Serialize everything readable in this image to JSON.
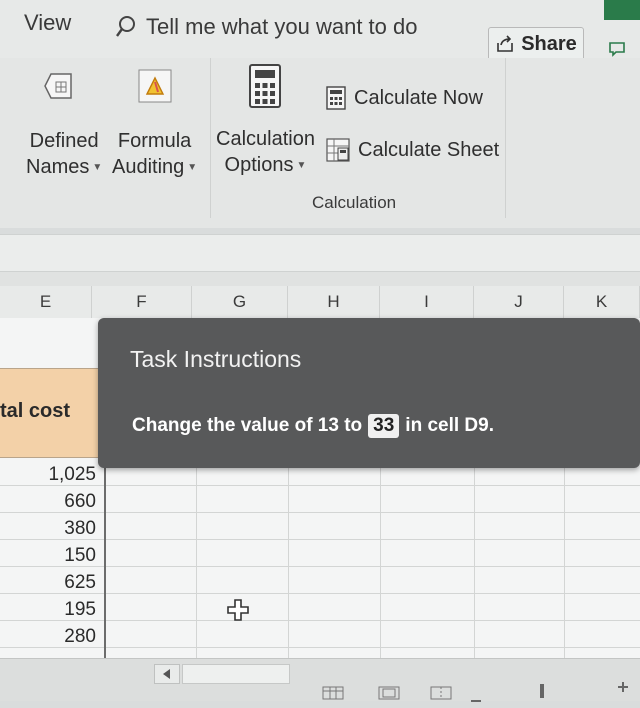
{
  "menu": {
    "view_label": "View",
    "tell_me": "Tell me what you want to do",
    "share_label": "Share"
  },
  "ribbon": {
    "defined_names_line1": "Defined",
    "defined_names_line2": "Names",
    "formula_auditing_line1": "Formula",
    "formula_auditing_line2": "Auditing",
    "calc_options_line1": "Calculation",
    "calc_options_line2": "Options",
    "calculate_now": "Calculate Now",
    "calculate_sheet": "Calculate Sheet",
    "group_label": "Calculation"
  },
  "grid": {
    "columns": [
      "E",
      "F",
      "G",
      "H",
      "I",
      "J",
      "K"
    ],
    "header_text": "tal cost",
    "values": [
      "1,025",
      "660",
      "380",
      "150",
      "625",
      "195",
      "280"
    ]
  },
  "task": {
    "title": "Task Instructions",
    "text_before": "Change the value of 13 to",
    "new_value": "33",
    "text_after": "in cell D9."
  },
  "colors": {
    "header_fill": "#f3d1a8",
    "panel_bg": "#58595a",
    "excel_green": "#2a7b4a"
  }
}
